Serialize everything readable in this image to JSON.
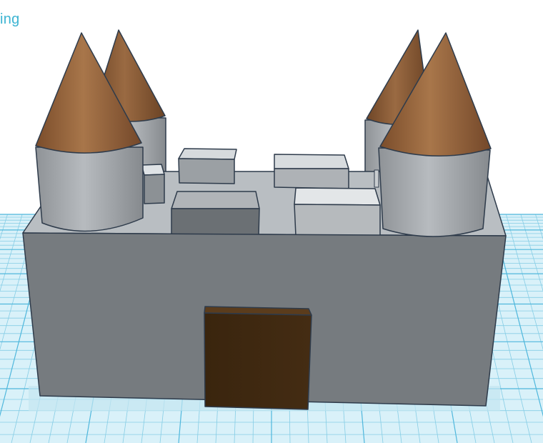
{
  "workspace": {
    "corner_label": "ing",
    "colors": {
      "background": "#ffffff",
      "grid_fill": "#d9f1f9",
      "grid_line": "#86cde5",
      "grid_major": "#4fb7dc",
      "accent_text": "#3cb4d2"
    }
  },
  "model": {
    "name": "castle",
    "colors": {
      "wall_front": "#767b7f",
      "wall_top": "#b9bec2",
      "tower_body": "#9ea2a6",
      "roof": "#8c5a35",
      "door": "#3e2810",
      "outline": "#2e3b4b"
    }
  }
}
